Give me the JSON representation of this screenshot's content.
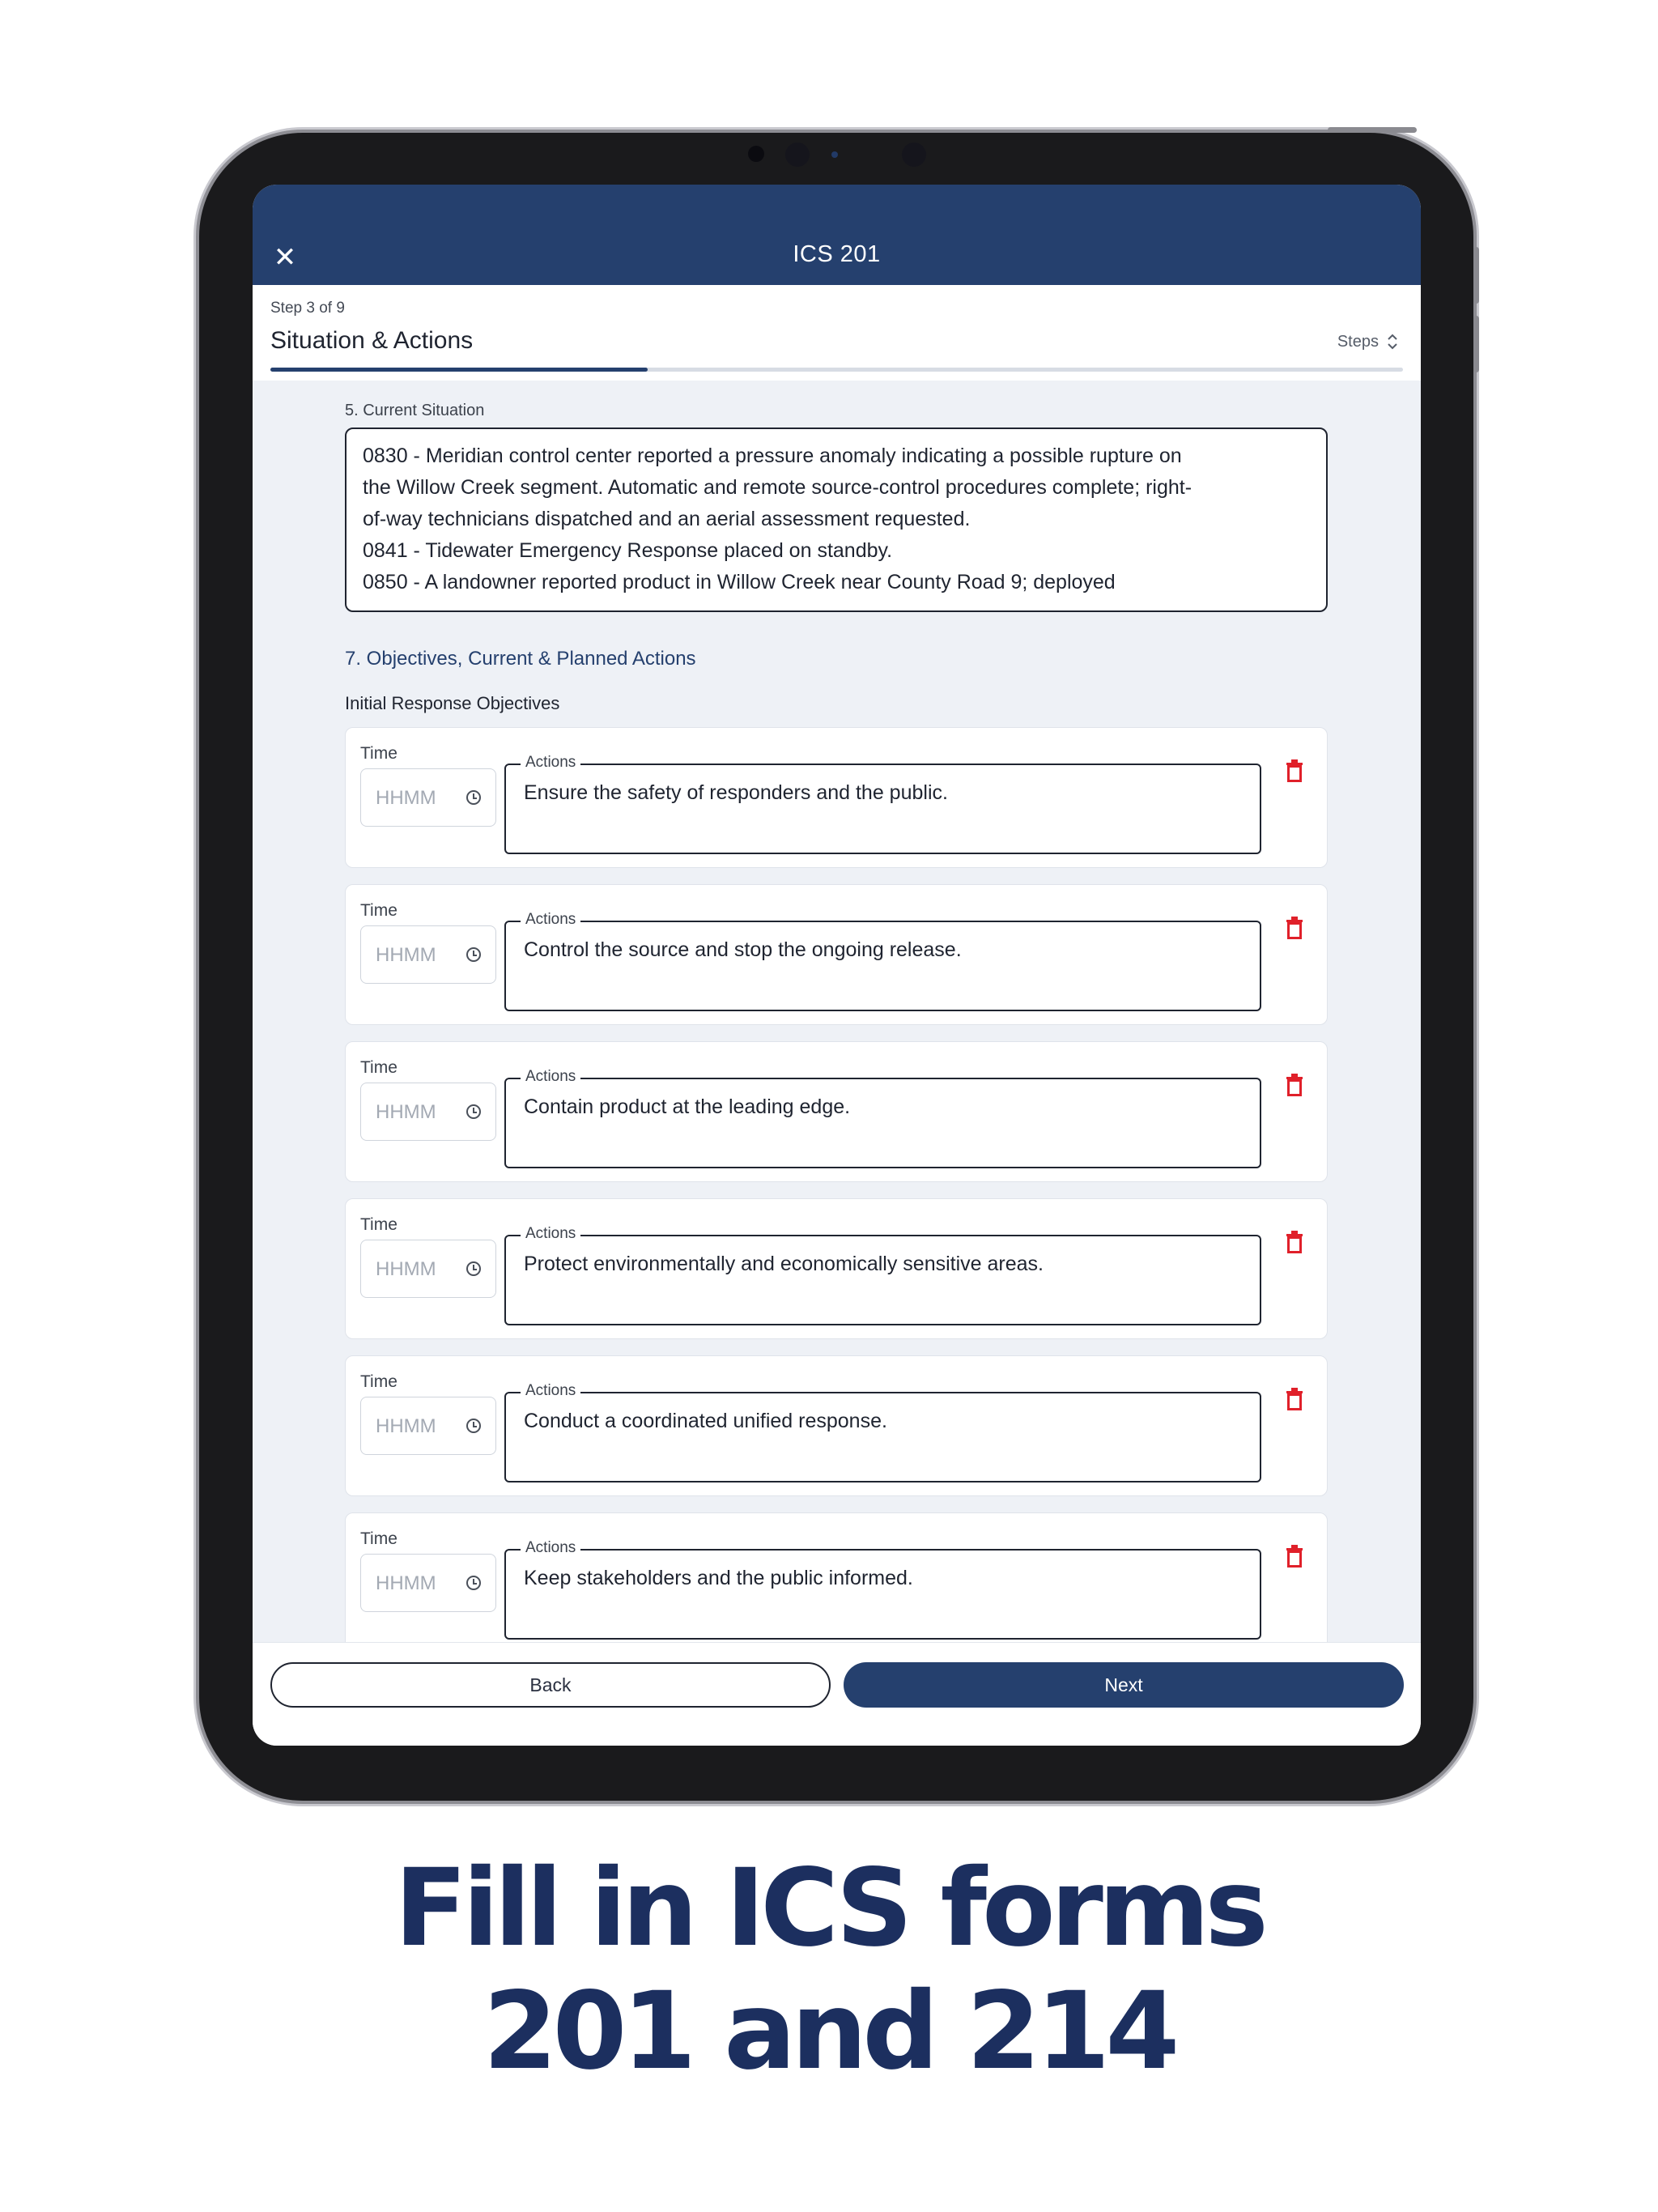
{
  "app": {
    "title": "ICS 201"
  },
  "step": {
    "counter": "Step 3 of 9",
    "title": "Situation & Actions",
    "steps_label": "Steps",
    "progress": 0.333
  },
  "situation": {
    "label": "5. Current Situation",
    "lines": [
      "0830 - Meridian control center reported a pressure anomaly indicating a possible rupture on",
      "the Willow Creek segment. Automatic and remote source-control procedures complete; right-",
      "of-way technicians dispatched and an aerial assessment requested.",
      "0841 - Tidewater Emergency Response placed on standby.",
      "0850 - A landowner reported product in Willow Creek near County Road 9; deployed"
    ]
  },
  "objectives": {
    "section_title": "7. Objectives, Current & Planned Actions",
    "subsection_title": "Initial Response Objectives",
    "time_label": "Time",
    "time_placeholder": "HHMM",
    "actions_label": "Actions",
    "items": [
      {
        "action": "Ensure the safety of responders and the public."
      },
      {
        "action": "Control the source and stop the ongoing release."
      },
      {
        "action": "Contain product at the leading edge."
      },
      {
        "action": "Protect environmentally and economically sensitive areas."
      },
      {
        "action": "Conduct a coordinated unified response."
      },
      {
        "action": "Keep stakeholders and the public informed."
      }
    ]
  },
  "footer": {
    "back_label": "Back",
    "next_label": "Next"
  },
  "caption": {
    "line1": "Fill in ICS forms",
    "line2": "201 and 214"
  },
  "colors": {
    "primary": "#25406e",
    "delete": "#e0202a",
    "background": "#eef1f6",
    "caption": "#1c2f5f"
  }
}
